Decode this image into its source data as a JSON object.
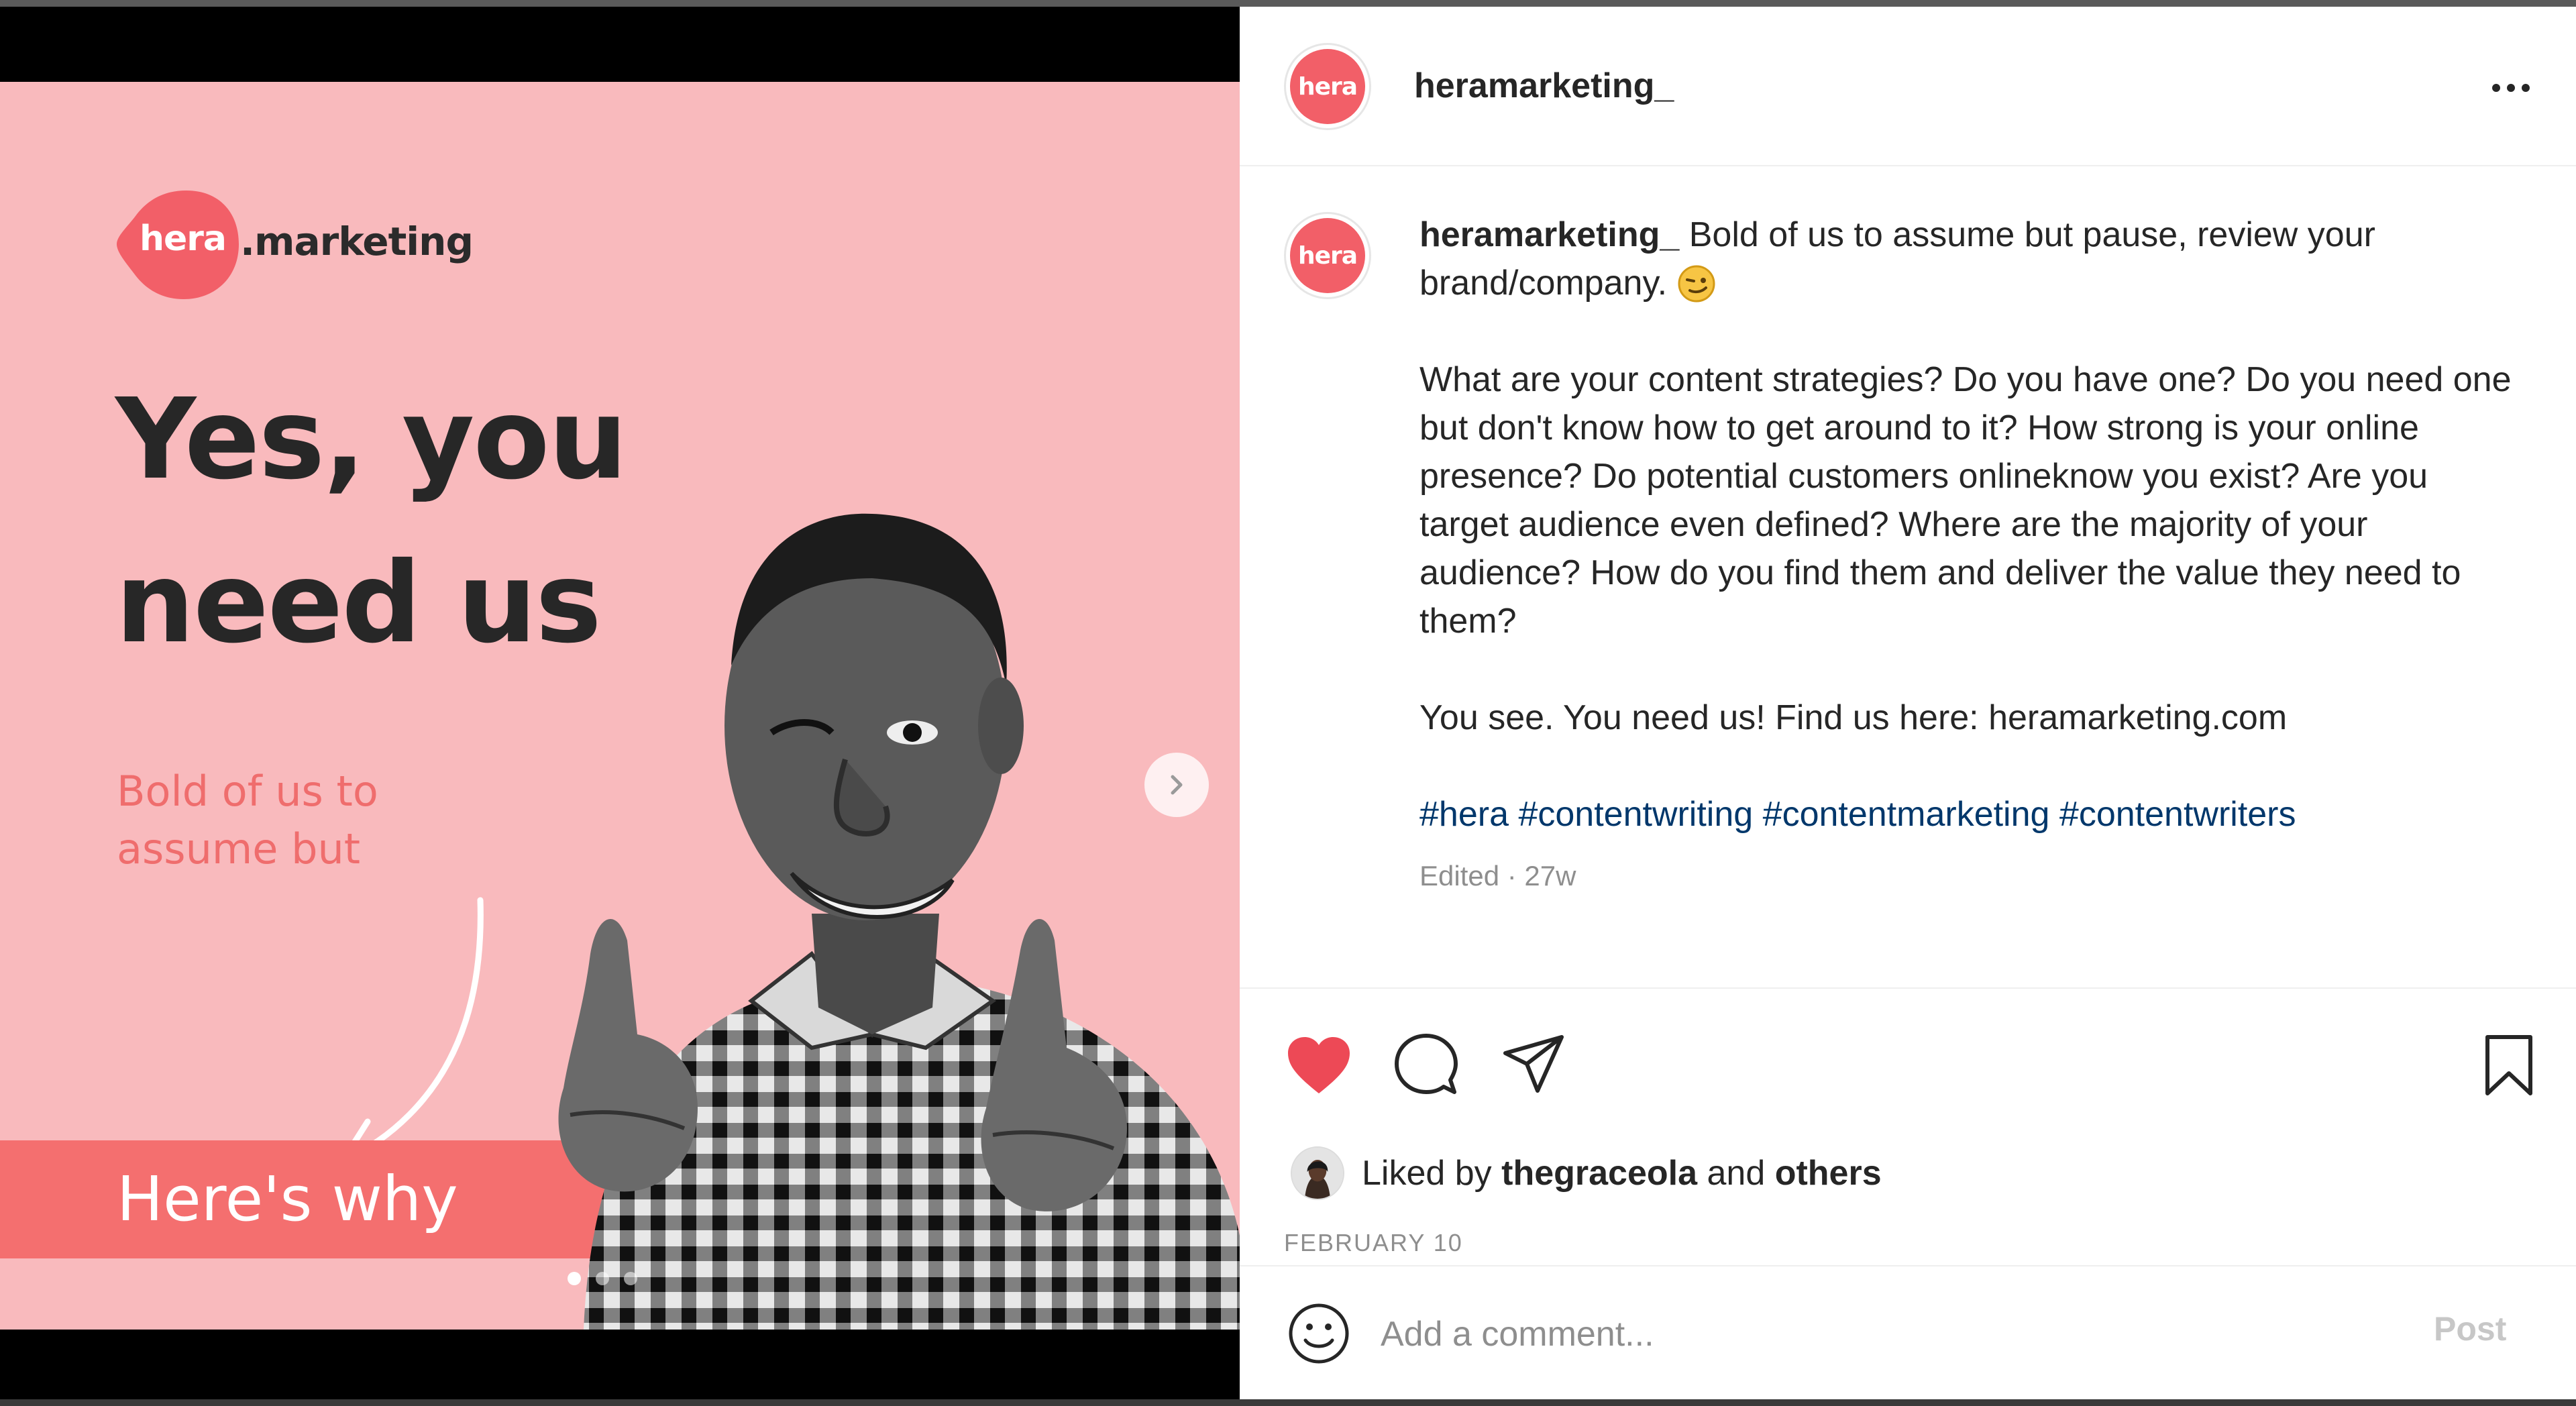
{
  "colors": {
    "slide_bg": "#f9babd",
    "brand_coral": "#f25f68",
    "accent_band": "#f46f6f",
    "like_red": "#ed4956",
    "hashtag_blue": "#00376b"
  },
  "slide": {
    "brand_blob": "hera",
    "brand_rest": ".marketing",
    "headline_line1": "Yes, you",
    "headline_line2": "need us",
    "subline_line1": "Bold of us to",
    "subline_line2": "assume but",
    "cta": "Here's why",
    "next_icon": "chevron-right-icon",
    "dots_count": 3,
    "active_dot": 1
  },
  "post": {
    "username": "heramarketing_",
    "avatar_text": "hera",
    "more_icon": "more-horizontal-icon"
  },
  "caption": {
    "username": "heramarketing_",
    "first_line": "Bold of us to assume but pause, review your brand/company.",
    "emoji": "winking-face-icon",
    "paragraph": "What are your content strategies? Do you have one? Do you need one but don't know how to get around to it? How strong is your online presence? Do potential customers onlineknow you exist? Are you target audience even defined? Where are the majority of your audience? How do you find them and deliver the value they need to them?",
    "cta_line": "You see. You need us! Find us here: heramarketing.com",
    "hashtags": "#hera #contentwriting #contentmarketing #contentwriters",
    "meta": "Edited · 27w"
  },
  "actions": {
    "like_icon": "heart-filled-icon",
    "comment_icon": "comment-icon",
    "share_icon": "paper-plane-icon",
    "save_icon": "bookmark-icon"
  },
  "likes": {
    "prefix": "Liked by",
    "user": "thegraceola",
    "joiner": "and",
    "others": "others"
  },
  "date": "FEBRUARY 10",
  "comment": {
    "placeholder": "Add a comment...",
    "post_label": "Post",
    "emoji_icon": "smiley-icon"
  }
}
